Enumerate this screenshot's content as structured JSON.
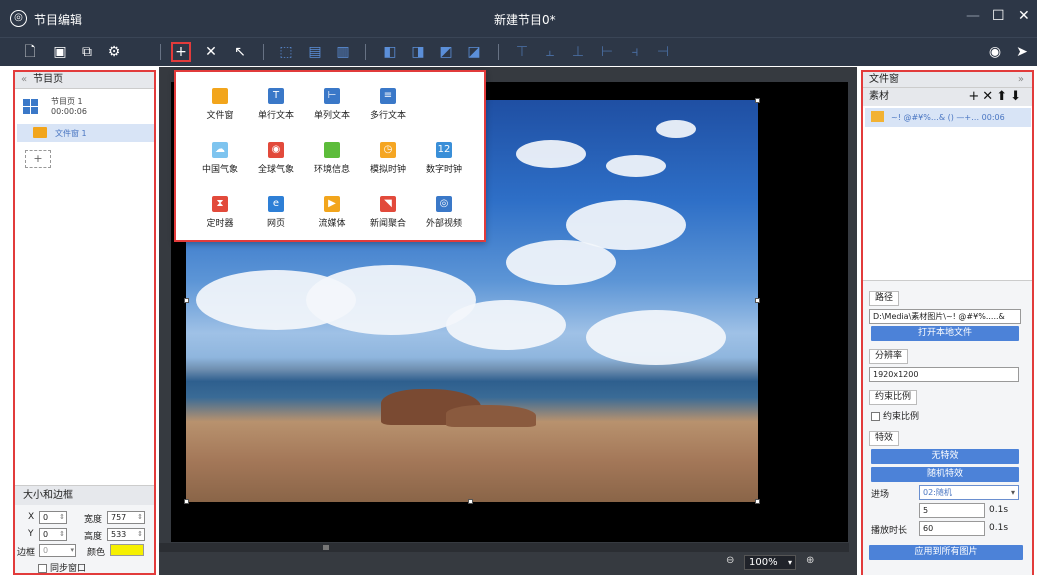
{
  "app": {
    "title": "节目编辑",
    "doc_title": "新建节目0*",
    "minimize": "—",
    "maximize": "☐",
    "close": "✕"
  },
  "toolbar": {
    "icons": [
      "new-file-icon",
      "save-icon",
      "export-icon",
      "settings-icon",
      "add-icon",
      "delete-icon",
      "pointer-icon",
      "fit-icon",
      "align-width-icon",
      "align-height-icon",
      "bring-front-icon",
      "send-back-icon",
      "layer-up-icon",
      "layer-down-icon",
      "align-top-icon",
      "align-vcenter-icon",
      "align-bottom-icon",
      "align-left-icon",
      "align-hcenter-icon",
      "align-right-icon",
      "preview-icon",
      "send-icon"
    ]
  },
  "left": {
    "header": "节目页",
    "collapse": "«",
    "page_name": "节目页 1",
    "page_duration": "00:00:06",
    "window_name": "文件窗 1",
    "add": "+",
    "size": {
      "title": "大小和边框",
      "x_label": "X",
      "x": "0",
      "y_label": "Y",
      "y": "0",
      "w_label": "宽度",
      "w": "757",
      "h_label": "高度",
      "h": "533",
      "border_label": "边框",
      "border": "0",
      "color_label": "颜色",
      "color": "#f6f000",
      "sync": "同步窗口"
    }
  },
  "popup": {
    "items": [
      {
        "label": "文件窗",
        "icon": "folder-icon",
        "color": "#f2a51c",
        "glyph": ""
      },
      {
        "label": "单行文本",
        "icon": "single-line-text-icon",
        "color": "#3a78c8",
        "glyph": "T"
      },
      {
        "label": "单列文本",
        "icon": "single-column-text-icon",
        "color": "#3a78c8",
        "glyph": "⊢"
      },
      {
        "label": "多行文本",
        "icon": "multi-line-text-icon",
        "color": "#3a78c8",
        "glyph": "≡"
      },
      {
        "label": "中国气象",
        "icon": "weather-icon",
        "color": "#7ec4ef",
        "glyph": "☁"
      },
      {
        "label": "全球气象",
        "icon": "globe-icon",
        "color": "#e24a3b",
        "glyph": "◉"
      },
      {
        "label": "环境信息",
        "icon": "leaf-icon",
        "color": "#5cbc3a",
        "glyph": ""
      },
      {
        "label": "模拟时钟",
        "icon": "analog-clock-icon",
        "color": "#f5a623",
        "glyph": "◷"
      },
      {
        "label": "数字时钟",
        "icon": "digital-clock-icon",
        "color": "#3a8fd8",
        "glyph": "12"
      },
      {
        "label": "定时器",
        "icon": "hourglass-icon",
        "color": "#e24a3b",
        "glyph": "⧗"
      },
      {
        "label": "网页",
        "icon": "browser-icon",
        "color": "#2e7fd6",
        "glyph": "e"
      },
      {
        "label": "流媒体",
        "icon": "stream-icon",
        "color": "#f2a51c",
        "glyph": "▶"
      },
      {
        "label": "新闻聚合",
        "icon": "rss-icon",
        "color": "#e24a3b",
        "glyph": "◥"
      },
      {
        "label": "外部视频",
        "icon": "webcam-icon",
        "color": "#3a78c8",
        "glyph": "◎"
      }
    ]
  },
  "canvas": {
    "zoom": "100%"
  },
  "right": {
    "header": "文件窗",
    "expand": "»",
    "materials": "素材",
    "item_text": "~! @#¥%…& () —+… 00:06",
    "path_label": "路径",
    "path": "D:\\Media\\素材图片\\~! @#¥%.....&",
    "open_local": "打开本地文件",
    "res_label": "分辨率",
    "resolution": "1920x1200",
    "ratio_label": "约束比例",
    "ratio_check": "约束比例",
    "effect_label": "特效",
    "no_effect": "无特效",
    "random_effect": "随机特效",
    "enter_label": "进场",
    "enter_value": "02:随机",
    "enter_time": "5",
    "unit": "0.1s",
    "play_label": "播放时长",
    "play_value": "60",
    "apply_all": "应用到所有图片"
  }
}
